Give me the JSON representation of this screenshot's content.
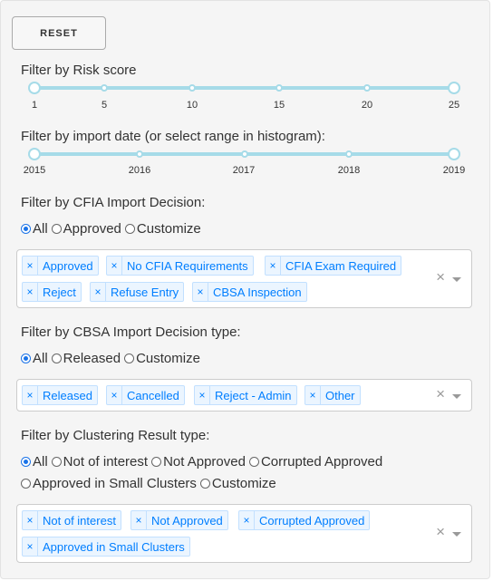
{
  "reset_label": "RESET",
  "risk": {
    "label": "Filter by Risk score",
    "ticks": [
      "1",
      "5",
      "10",
      "15",
      "20",
      "25"
    ],
    "range": [
      1,
      25
    ]
  },
  "date": {
    "label": "Filter by import date (or select range in histogram):",
    "ticks": [
      "2015",
      "2016",
      "2017",
      "2018",
      "2019"
    ],
    "range": [
      "2015",
      "2019"
    ]
  },
  "cfia": {
    "label": "Filter by CFIA Import Decision:",
    "options": [
      "All",
      "Approved",
      "Customize"
    ],
    "selected": "All",
    "tags": [
      "Approved",
      "No CFIA Requirements",
      "CFIA Exam Required",
      "Reject",
      "Refuse Entry",
      "CBSA Inspection"
    ]
  },
  "cbsa": {
    "label": "Filter by CBSA Import Decision type:",
    "options": [
      "All",
      "Released",
      "Customize"
    ],
    "selected": "All",
    "tags": [
      "Released",
      "Cancelled",
      "Reject - Admin",
      "Other"
    ]
  },
  "cluster": {
    "label": "Filter by Clustering Result type:",
    "options": [
      "All",
      "Not of interest",
      "Not Approved",
      "Corrupted Approved",
      "Approved in Small Clusters",
      "Customize"
    ],
    "selected": "All",
    "tags": [
      "Not of interest",
      "Not Approved",
      "Corrupted Approved",
      "Approved in Small Clusters"
    ]
  },
  "tag_remove_symbol": "×",
  "clear_symbol": "×",
  "colors": {
    "accent": "#a6dbe8",
    "tag_text": "#007eff",
    "tag_bg": "#ebf5ff",
    "radio_selected": "#1a73e8"
  }
}
